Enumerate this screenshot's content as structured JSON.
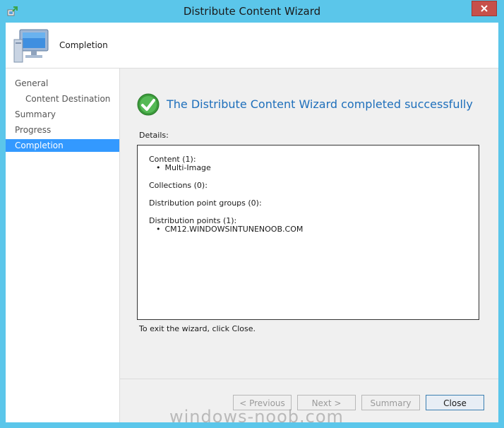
{
  "window": {
    "title": "Distribute Content Wizard",
    "header_title": "Completion"
  },
  "nav": {
    "items": [
      {
        "label": "General"
      },
      {
        "label": "Content Destination"
      },
      {
        "label": "Summary"
      },
      {
        "label": "Progress"
      },
      {
        "label": "Completion"
      }
    ]
  },
  "main": {
    "headline": "The Distribute Content Wizard completed successfully",
    "details_label": "Details:",
    "details": {
      "content_heading": "Content (1):",
      "content_item": "Multi-Image",
      "collections_heading": "Collections (0):",
      "dp_groups_heading": "Distribution point groups (0):",
      "dp_heading": "Distribution points (1):",
      "dp_item": "CM12.WINDOWSINTUNENOOB.COM"
    },
    "exit_text": "To exit the wizard, click Close."
  },
  "buttons": {
    "previous": "< Previous",
    "next": "Next >",
    "summary": "Summary",
    "close": "Close"
  },
  "watermark": "windows-noob.com",
  "colors": {
    "frame": "#5bc6ea",
    "accent": "#3399ff",
    "headline": "#1e6fbb",
    "close_button": "#c7504a"
  }
}
